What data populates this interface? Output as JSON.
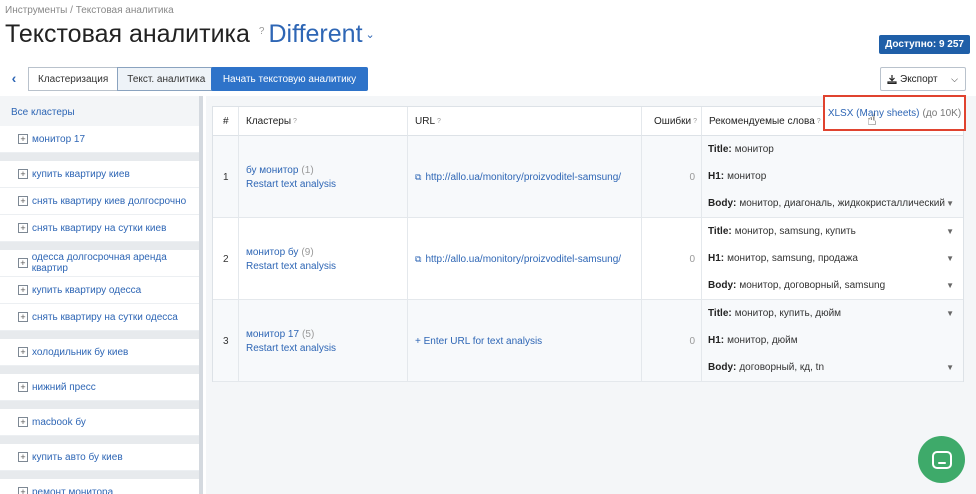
{
  "breadcrumb": "Инструменты / Текстовая аналитика",
  "page_title": "Текстовая аналитика",
  "help_mark": "?",
  "project": "Different",
  "balance": "Доступно: 9 257",
  "tabs": [
    "Кластеризация",
    "Текст. аналитика"
  ],
  "start_button": "Начать текстовую аналитику",
  "export_button": "Экспорт",
  "dropdown": {
    "format": "XLSX (Many sheets)",
    "note": "(до 10K)"
  },
  "sidebar": {
    "all_label": "Все кластеры",
    "groups": [
      [
        "монитор 17"
      ],
      [
        "купить квартиру киев",
        "снять квартиру киев долгосрочно",
        "снять квартиру на сутки киев"
      ],
      [
        "одесса долгосрочная аренда квартир",
        "купить квартиру одесса",
        "снять квартиру на сутки одесса"
      ],
      [
        "холодильник бу киев"
      ],
      [
        "нижний пресс"
      ],
      [
        "macbook бу"
      ],
      [
        "купить авто бу киев"
      ],
      [
        "ремонт монитора"
      ]
    ]
  },
  "table": {
    "headers": [
      "#",
      "Кластеры",
      "URL",
      "Ошибки",
      "Рекомендуемые слова"
    ],
    "rows": [
      {
        "num": "1",
        "cluster": "бу монитор",
        "count": "(1)",
        "restart": "Restart text analysis",
        "url": "http://allo.ua/monitory/proizvoditel-samsung/",
        "errors": "0",
        "title": "монитор",
        "h1": "монитор",
        "body": "монитор, диагональ, жидкокристаллический"
      },
      {
        "num": "2",
        "cluster": "монитор бу",
        "count": "(9)",
        "restart": "Restart text analysis",
        "url": "http://allo.ua/monitory/proizvoditel-samsung/",
        "errors": "0",
        "title": "монитор, samsung, купить",
        "h1": "монитор, samsung, продажа",
        "body": "монитор, договорный, samsung"
      },
      {
        "num": "3",
        "cluster": "монитор 17",
        "count": "(5)",
        "restart": "Restart text analysis",
        "url": "+ Enter URL for text analysis",
        "errors": "0",
        "title": "монитор, купить, дюйм",
        "h1": "монитор, дюйм",
        "body": "договорный, кд, tn"
      }
    ],
    "labels": {
      "title": "Title:",
      "h1": "H1:",
      "body": "Body:"
    }
  },
  "colors": {
    "accent": "#2e66b5",
    "button": "#2e73c9",
    "highlight": "#e0432f",
    "chat": "#3eaa6a"
  }
}
